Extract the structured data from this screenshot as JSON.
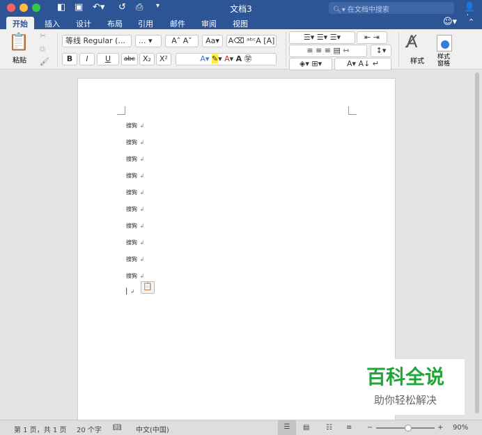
{
  "window": {
    "title": "文档3",
    "search_placeholder": "在文档中搜索"
  },
  "tabs": [
    "开始",
    "插入",
    "设计",
    "布局",
    "引用",
    "邮件",
    "审阅",
    "视图"
  ],
  "ribbon": {
    "paste": "粘贴",
    "font_name": "等线 Regular (...",
    "font_size": "...",
    "bold": "B",
    "italic": "I",
    "underline": "U",
    "strike": "abc",
    "subscript": "X₂",
    "superscript": "X²",
    "styles": "样式",
    "styles_pane": "样式\n窗格"
  },
  "document": {
    "lines": [
      "搜狗",
      "搜狗",
      "搜狗",
      "搜狗",
      "搜狗",
      "搜狗",
      "搜狗",
      "搜狗",
      "搜狗",
      "搜狗"
    ],
    "paragraph_mark": "↲"
  },
  "status": {
    "page": "第 1 页，共 1 页",
    "words": "20 个字",
    "language": "中文(中国)",
    "zoom": "90%",
    "zoom_level": 0.55
  },
  "watermark": {
    "title": "百科全说",
    "subtitle": "助你轻松解决"
  },
  "colors": {
    "brand": "#2d5596"
  }
}
